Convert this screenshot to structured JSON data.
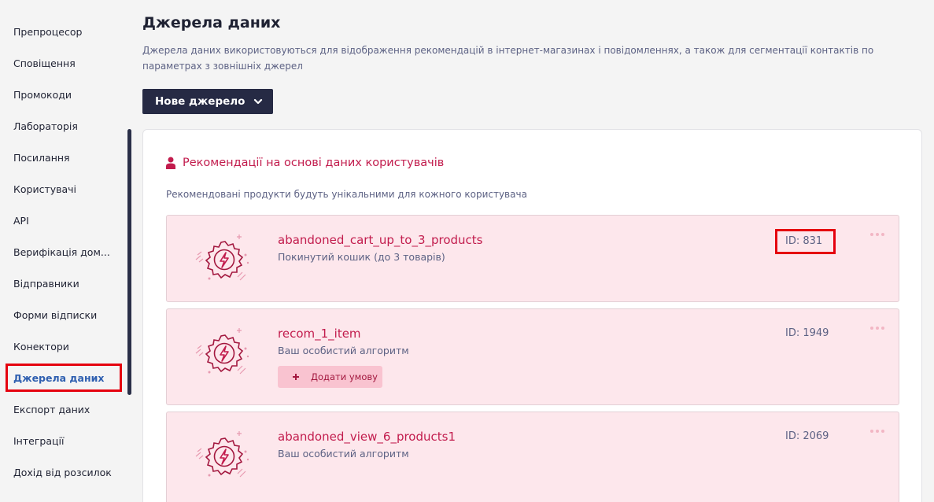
{
  "sidebar": {
    "items": [
      {
        "label": "Препроцесор"
      },
      {
        "label": "Сповіщення"
      },
      {
        "label": "Промокоди"
      },
      {
        "label": "Лабораторія"
      },
      {
        "label": "Посилання"
      },
      {
        "label": "Користувачі"
      },
      {
        "label": "API"
      },
      {
        "label": "Верифікація дом..."
      },
      {
        "label": "Відправники"
      },
      {
        "label": "Форми відписки"
      },
      {
        "label": "Конектори"
      },
      {
        "label": "Джерела даних"
      },
      {
        "label": "Експорт даних"
      },
      {
        "label": "Інтеграції"
      },
      {
        "label": "Дохід від розсилок"
      }
    ],
    "active_item": "Джерела даних"
  },
  "page": {
    "title": "Джерела даних",
    "description": "Джерела даних використовуються для відображення рекомендацій в інтернет-магазинах і повідомленнях, а також для сегментації контактів по параметрах з зовнішніх джерел"
  },
  "toolbar": {
    "new_source_label": "Нове джерело",
    "new_source_icon": "chevron-down-icon"
  },
  "section": {
    "icon": "user-icon",
    "title": "Рекомендації на основі даних користувачів",
    "subtitle": "Рекомендовані продукти будуть унікальними для кожного користувача"
  },
  "cards": [
    {
      "name": "abandoned_cart_up_to_3_products",
      "description": "Покинутий кошик (до 3 товарів)",
      "id_label": "ID: 831"
    },
    {
      "name": "recom_1_item",
      "description": "Ваш особистий алгоритм",
      "id_label": "ID: 1949",
      "add_condition_label": "Додати умову"
    },
    {
      "name": "abandoned_view_6_products1",
      "description": "Ваш особистий алгоритм",
      "id_label": "ID: 2069"
    }
  ],
  "colors": {
    "accent": "#c21c4d",
    "card_bg": "#fde7ec",
    "button_dark": "#262a44",
    "active_link": "#2f5fb0",
    "highlight_border": "#e5000e"
  }
}
